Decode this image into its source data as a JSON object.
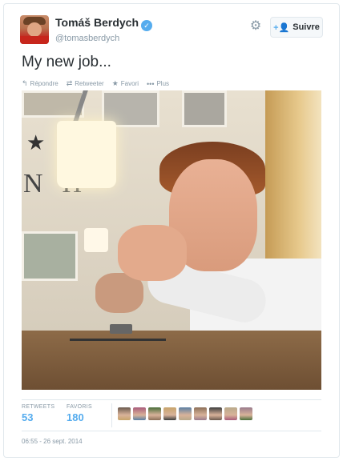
{
  "header": {
    "display_name": "Tomáš Berdych",
    "handle": "@tomasberdych",
    "follow_label": "Suivre",
    "verified_icon": "verified-badge-icon",
    "settings_icon": "gear-icon"
  },
  "tweet": {
    "text": "My new job..."
  },
  "actions": {
    "reply": "Répondre",
    "retweet": "Retweeter",
    "favorite": "Favori",
    "more": "Plus"
  },
  "stats": {
    "retweets_label": "RETWEETS",
    "retweets_count": "53",
    "favorites_label": "FAVORIS",
    "favorites_count": "180",
    "favoriters_count": 9
  },
  "meta": {
    "timestamp": "06:55 - 26 sept. 2014"
  },
  "colors": {
    "accent": "#55acee",
    "text": "#292f33",
    "muted": "#8899a6",
    "border": "#e1e8ed"
  }
}
